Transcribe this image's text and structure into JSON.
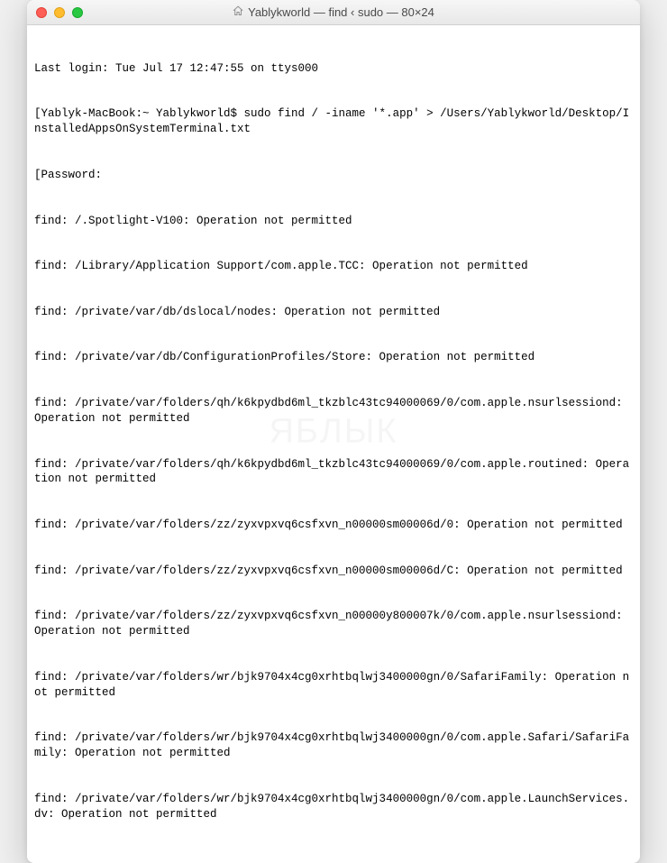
{
  "window": {
    "title": "Yablykworld — find ‹ sudo — 80×24"
  },
  "terminal": {
    "lines": [
      "Last login: Tue Jul 17 12:47:55 on ttys000",
      "[Yablyk-MacBook:~ Yablykworld$ sudo find / -iname '*.app' > /Users/Yablykworld/Desktop/InstalledAppsOnSystemTerminal.txt",
      "[Password:",
      "find: /.Spotlight-V100: Operation not permitted",
      "find: /Library/Application Support/com.apple.TCC: Operation not permitted",
      "find: /private/var/db/dslocal/nodes: Operation not permitted",
      "find: /private/var/db/ConfigurationProfiles/Store: Operation not permitted",
      "find: /private/var/folders/qh/k6kpydbd6ml_tkzblc43tc94000069/0/com.apple.nsurlsessiond: Operation not permitted",
      "find: /private/var/folders/qh/k6kpydbd6ml_tkzblc43tc94000069/0/com.apple.routined: Operation not permitted",
      "find: /private/var/folders/zz/zyxvpxvq6csfxvn_n00000sm00006d/0: Operation not permitted",
      "find: /private/var/folders/zz/zyxvpxvq6csfxvn_n00000sm00006d/C: Operation not permitted",
      "find: /private/var/folders/zz/zyxvpxvq6csfxvn_n00000y800007k/0/com.apple.nsurlsessiond: Operation not permitted",
      "find: /private/var/folders/wr/bjk9704x4cg0xrhtbqlwj3400000gn/0/SafariFamily: Operation not permitted",
      "find: /private/var/folders/wr/bjk9704x4cg0xrhtbqlwj3400000gn/0/com.apple.Safari/SafariFamily: Operation not permitted",
      "find: /private/var/folders/wr/bjk9704x4cg0xrhtbqlwj3400000gn/0/com.apple.LaunchServices.dv: Operation not permitted"
    ]
  },
  "watermark": "ЯБЛЫК"
}
